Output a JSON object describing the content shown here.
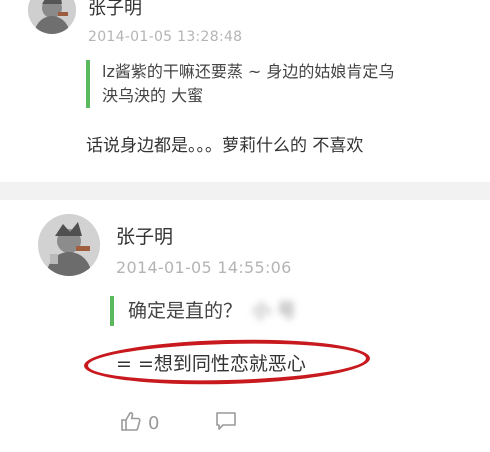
{
  "comments": [
    {
      "author": "张子明",
      "timestamp": "2014-01-05 13:28:48",
      "quoted_line1": "lz酱紫的干嘛还要蒸 ~ 身边的姑娘肯定乌",
      "quoted_line2": "泱乌泱的 大蜜",
      "reply": "话说身边都是。。。萝莉什么的 不喜欢"
    },
    {
      "author": "张子明",
      "timestamp": "2014-01-05 14:55:06",
      "quoted_text": "确定是直的？",
      "quoted_blurred_name": "小  号",
      "reply": "= =想到同性恋就恶心",
      "like_count": "0"
    }
  ],
  "icons": {
    "like": "thumbs-up-icon",
    "comment": "comment-bubble-icon"
  },
  "colors": {
    "quote_bar": "#5bb85c",
    "highlight_ring": "#c8191e",
    "timestamp": "#b4b4b4"
  }
}
